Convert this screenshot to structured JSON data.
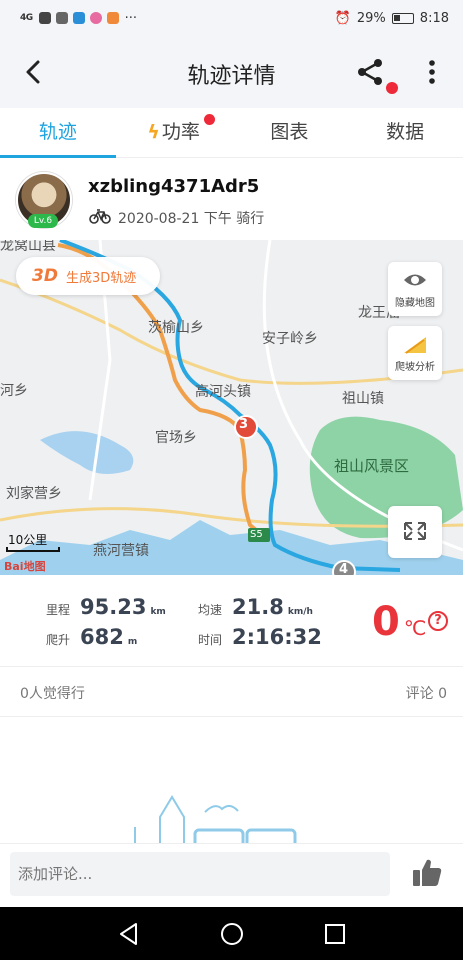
{
  "status_bar": {
    "signal": "4G",
    "more": "···",
    "battery": "29%",
    "time": "8:18"
  },
  "header": {
    "title": "轨迹详情"
  },
  "tabs": [
    {
      "label": "轨迹",
      "active": true
    },
    {
      "label": "功率",
      "active": false
    },
    {
      "label": "图表",
      "active": false
    },
    {
      "label": "数据",
      "active": false
    }
  ],
  "user": {
    "name": "xzbling4371Adr5",
    "level": "Lv.6",
    "meta": "2020-08-21 下午 骑行"
  },
  "map": {
    "btn_3d_big": "3D",
    "btn_3d_label": "生成3D轨迹",
    "hide_map_label": "隐藏地图",
    "climb_label": "爬坡分析",
    "scale_label": "10公里",
    "baidu": "Bai地图",
    "marker_3": "3",
    "marker_4": "4",
    "road_sign": "S5",
    "places": [
      "龙王庙",
      "茨榆山乡",
      "安子岭乡",
      "河乡",
      "高河头镇",
      "祖山镇",
      "官场乡",
      "祖山风景区",
      "刘家营乡",
      "燕河营镇",
      "龙窝山县"
    ]
  },
  "stats": {
    "distance_label": "里程",
    "distance_value": "95.23",
    "distance_unit": "km",
    "speed_label": "均速",
    "speed_value": "21.8",
    "speed_unit": "km/h",
    "climb_label": "爬升",
    "climb_value": "682",
    "climb_unit": "m",
    "time_label": "时间",
    "time_value": "2:16:32",
    "temp_value": "0",
    "temp_unit": "℃"
  },
  "likes": {
    "likes_text": "0人觉得行",
    "comments_text": "评论 0"
  },
  "comment": {
    "placeholder": "添加评论..."
  },
  "colors": {
    "accent": "#1fa4e0",
    "route_blue": "#2aa6e0",
    "route_orange": "#f0a04a",
    "temp_red": "#e8343a"
  }
}
